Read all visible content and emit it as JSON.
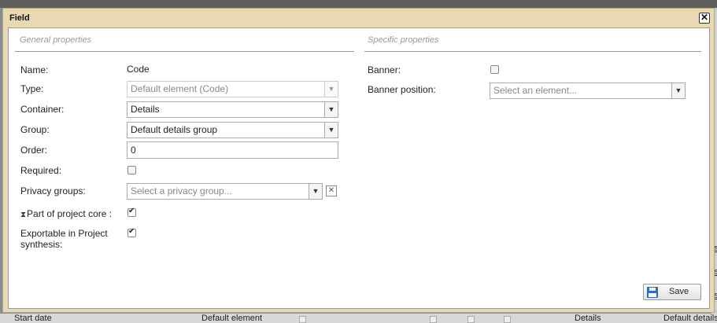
{
  "dialog": {
    "title": "Field",
    "close_symbol": "✕"
  },
  "general": {
    "title": "General properties",
    "name_label": "Name:",
    "name_value": "Code",
    "type_label": "Type:",
    "type_value": "Default element (Code)",
    "container_label": "Container:",
    "container_value": "Details",
    "group_label": "Group:",
    "group_value": "Default details group",
    "order_label": "Order:",
    "order_value": "0",
    "required_label": "Required:",
    "required_checked": false,
    "privacy_label": "Privacy groups:",
    "privacy_placeholder": "Select a privacy group...",
    "core_label": "Part of project core :",
    "core_checked": true,
    "exportable_label_line1": "Exportable in Project",
    "exportable_label_line2": "synthesis:",
    "exportable_checked": true
  },
  "specific": {
    "title": "Specific properties",
    "banner_label": "Banner:",
    "banner_checked": false,
    "banner_position_label": "Banner position:",
    "banner_position_placeholder": "Select an element..."
  },
  "actions": {
    "save_label": "Save"
  },
  "background": {
    "row_cells": [
      "Start date",
      "Default element",
      "Details",
      "Default details"
    ],
    "right_links": [
      "ls",
      "ls",
      "ls"
    ]
  },
  "icons": {
    "dropdown": "chevron-down-icon",
    "save": "floppy-disk-icon",
    "core": "hourglass-icon",
    "close": "close-icon"
  }
}
